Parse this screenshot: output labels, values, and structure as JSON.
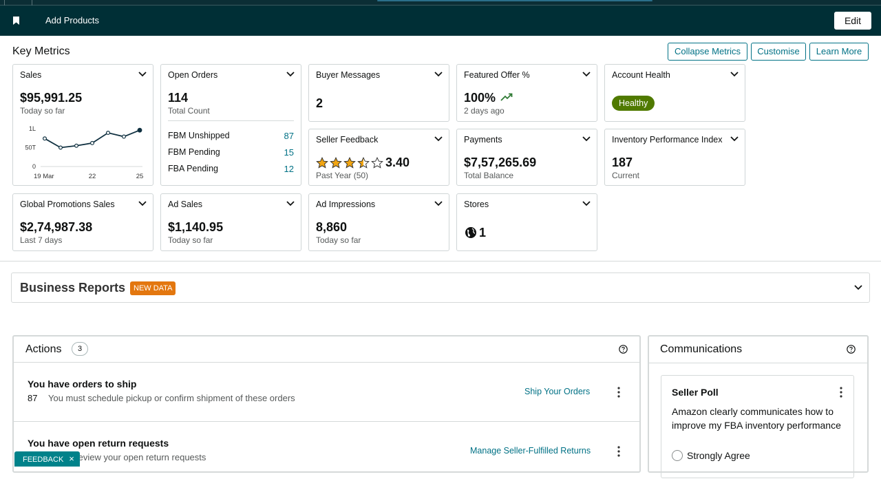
{
  "navbar": {
    "title": "Add Products",
    "edit_label": "Edit"
  },
  "key_metrics": {
    "title": "Key Metrics",
    "buttons": {
      "collapse": "Collapse Metrics",
      "customise": "Customise",
      "learn_more": "Learn More"
    },
    "sales": {
      "title": "Sales",
      "value": "$95,991.25",
      "sub": "Today so far",
      "chart_data": {
        "type": "line",
        "y_tick_labels": [
          "1L",
          "50T",
          "0"
        ],
        "x_tick_labels": [
          "19 Mar",
          "22",
          "25"
        ],
        "values": [
          74000,
          50000,
          55000,
          62000,
          89000,
          79000,
          96000
        ],
        "ylim": [
          0,
          100000
        ]
      }
    },
    "open_orders": {
      "title": "Open Orders",
      "value": "114",
      "sub": "Total Count",
      "rows": [
        {
          "label": "FBM Unshipped",
          "value": "87"
        },
        {
          "label": "FBM Pending",
          "value": "15"
        },
        {
          "label": "FBA Pending",
          "value": "12"
        }
      ]
    },
    "buyer_messages": {
      "title": "Buyer Messages",
      "value": "2"
    },
    "featured_offer": {
      "title": "Featured Offer %",
      "value": "100%",
      "sub": "2 days ago",
      "trend_color": "#2f7a34"
    },
    "account_health": {
      "title": "Account Health",
      "badge": "Healthy",
      "badge_color": "#507a00"
    },
    "seller_feedback": {
      "title": "Seller Feedback",
      "rating": 3.4,
      "value": "3.40",
      "sub": "Past Year (50)",
      "star_color": "#f1a512"
    },
    "payments": {
      "title": "Payments",
      "value": "$7,57,265.69",
      "sub": "Total Balance"
    },
    "inventory_perf": {
      "title": "Inventory Performance Index",
      "value": "187",
      "sub": "Current"
    },
    "global_promotions": {
      "title": "Global Promotions Sales",
      "value": "$2,74,987.38",
      "sub": "Last 7 days"
    },
    "ad_sales": {
      "title": "Ad Sales",
      "value": "$1,140.95",
      "sub": "Today so far"
    },
    "ad_impressions": {
      "title": "Ad Impressions",
      "value": "8,860",
      "sub": "Today so far"
    },
    "stores": {
      "title": "Stores",
      "value": "1",
      "icon": "globe-icon"
    }
  },
  "business_reports": {
    "title": "Business Reports",
    "badge": "NEW DATA"
  },
  "actions": {
    "title": "Actions",
    "count": "3",
    "items": [
      {
        "heading": "You have orders to ship",
        "number": "87",
        "desc": "You must schedule pickup or confirm shipment of these orders",
        "link": "Ship Your Orders"
      },
      {
        "heading": "You have open return requests",
        "number": "",
        "desc": "se review your open return requests",
        "link": "Manage Seller-Fulfilled Returns"
      }
    ]
  },
  "communications": {
    "title": "Communications",
    "poll": {
      "title": "Seller Poll",
      "question": "Amazon clearly communicates how to improve my FBA inventory performance",
      "option": "Strongly Agree"
    }
  },
  "feedback": {
    "label": "FEEDBACK",
    "close": "×"
  },
  "colors": {
    "nav_bg": "#002f36",
    "link": "#007185",
    "badge_orange": "#e3770f"
  }
}
